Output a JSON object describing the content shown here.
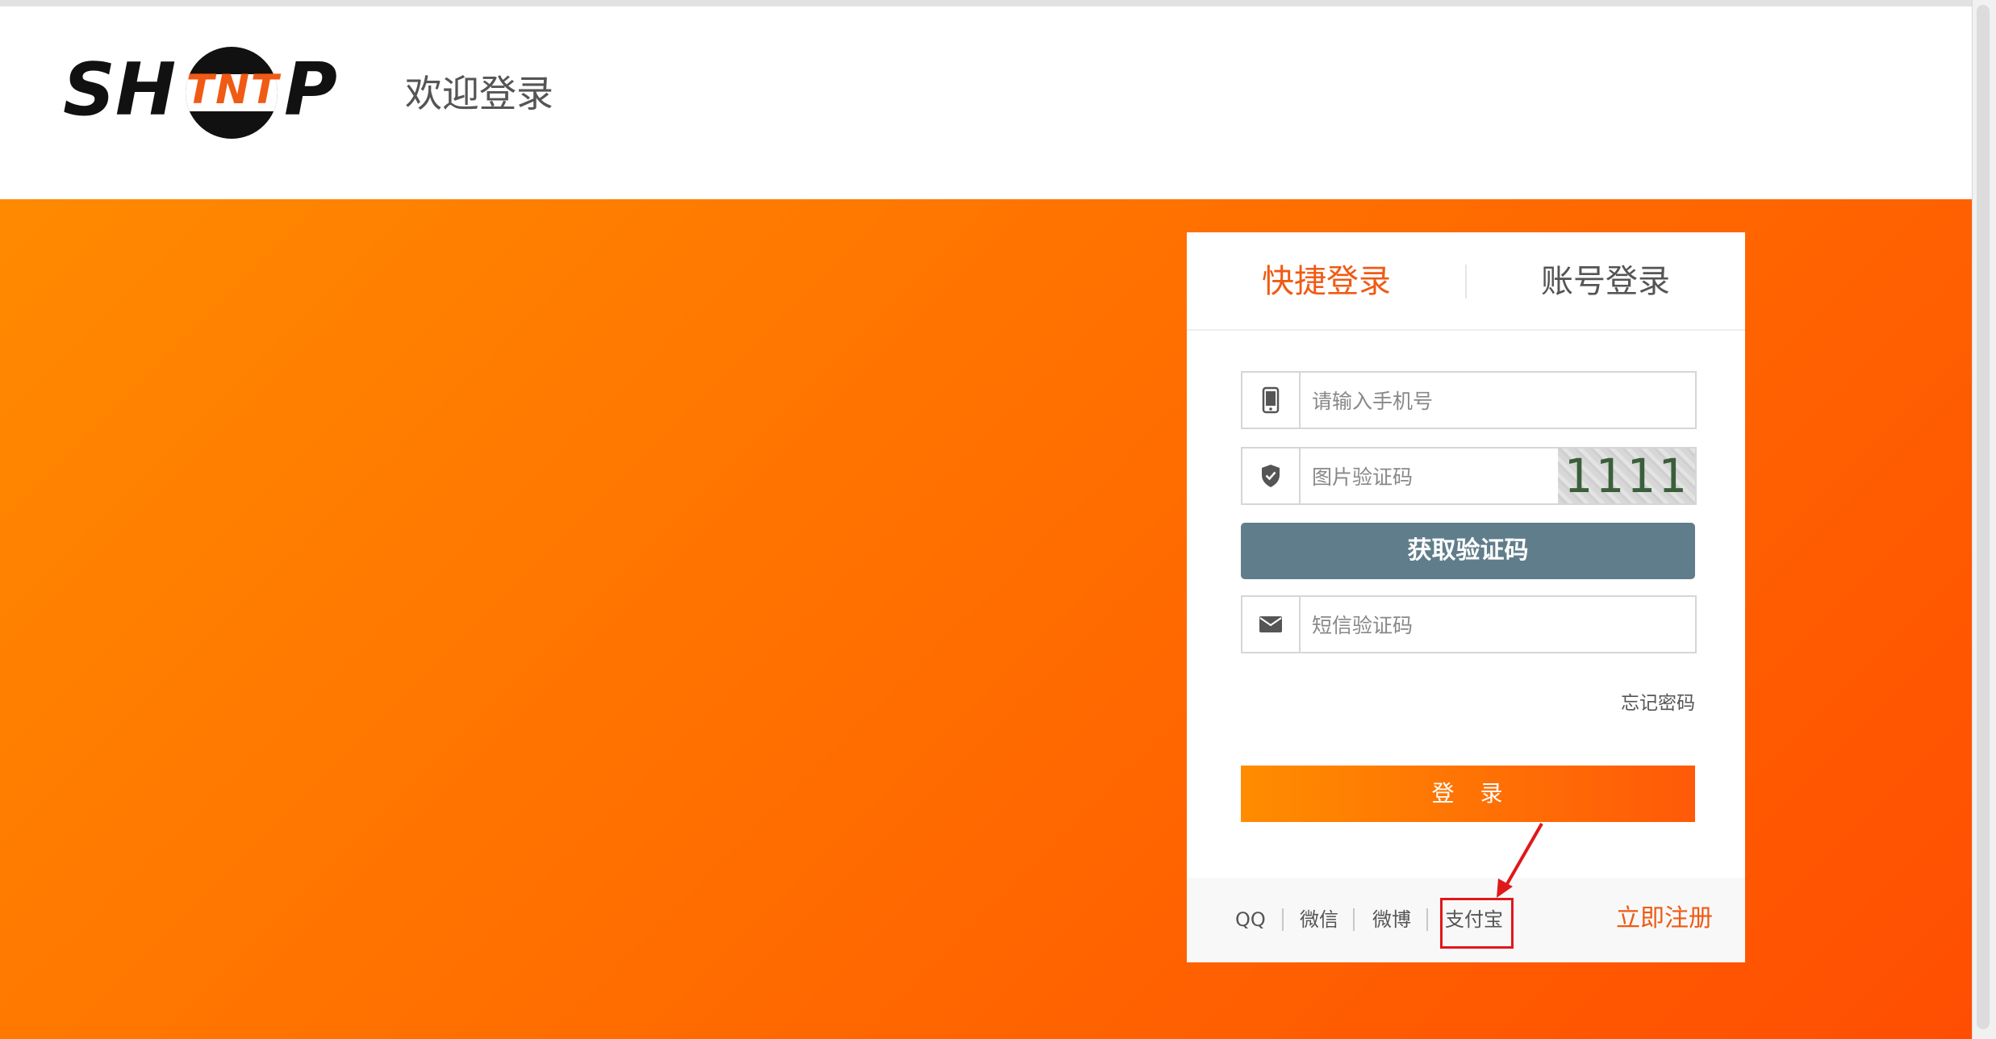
{
  "header": {
    "logo": {
      "left": "SH",
      "mid": "TNT",
      "right": "P"
    },
    "welcome": "欢迎登录"
  },
  "login": {
    "tabs": [
      {
        "label": "快捷登录",
        "active": true
      },
      {
        "label": "账号登录",
        "active": false
      }
    ],
    "phone": {
      "placeholder": "请输入手机号",
      "icon": "mobile-phone-icon"
    },
    "captcha": {
      "placeholder": "图片验证码",
      "image_text": "1111",
      "icon": "shield-check-icon"
    },
    "get_code_label": "获取验证码",
    "sms": {
      "placeholder": "短信验证码",
      "icon": "envelope-icon"
    },
    "forgot_label": "忘记密码",
    "login_label": "登　录",
    "social": [
      "QQ",
      "微信",
      "微博",
      "支付宝"
    ],
    "register_label": "立即注册"
  },
  "colors": {
    "accent": "#f05a14",
    "banner_start": "#ff8a00",
    "banner_end": "#ff4e02",
    "get_code_button": "#607d8b",
    "highlight": "#e0181b"
  }
}
